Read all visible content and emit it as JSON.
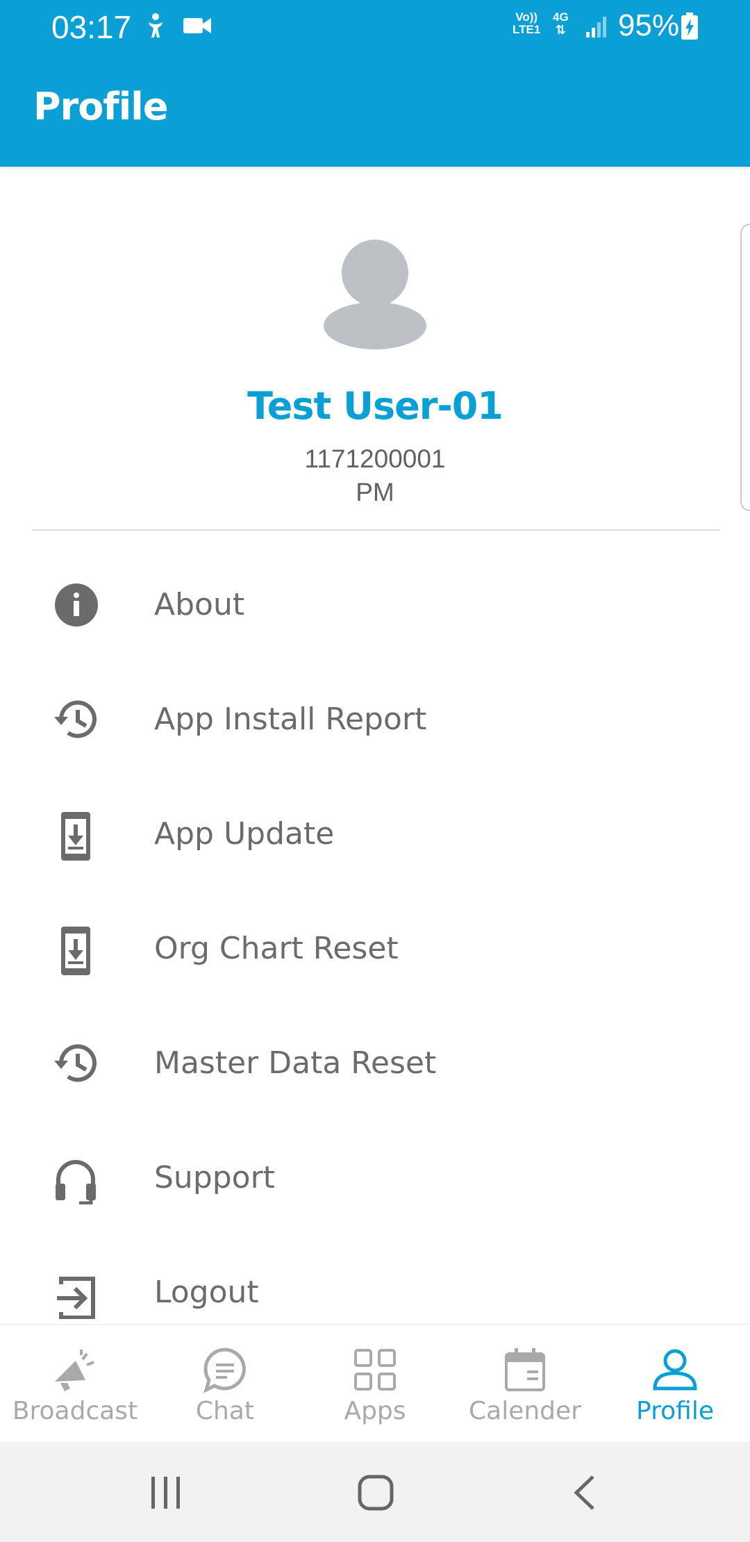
{
  "status_bar": {
    "time": "03:17",
    "network_top": "Vo))",
    "network_bottom": "LTE1",
    "generation": "4G",
    "battery": "95%"
  },
  "app_bar": {
    "title": "Profile"
  },
  "profile": {
    "name": "Test User-01",
    "id": "1171200001",
    "role": "PM"
  },
  "menu": {
    "items": [
      {
        "label": "About",
        "icon": "info-icon"
      },
      {
        "label": "App Install Report",
        "icon": "history-icon"
      },
      {
        "label": "App Update",
        "icon": "phone-download-icon"
      },
      {
        "label": "Org Chart Reset",
        "icon": "phone-download-icon"
      },
      {
        "label": "Master Data Reset",
        "icon": "history-icon"
      },
      {
        "label": "Support",
        "icon": "headset-icon"
      },
      {
        "label": "Logout",
        "icon": "logout-icon"
      }
    ]
  },
  "bottom_nav": {
    "items": [
      {
        "label": "Broadcast",
        "icon": "megaphone-icon"
      },
      {
        "label": "Chat",
        "icon": "chat-bubble-icon"
      },
      {
        "label": "Apps",
        "icon": "grid-icon"
      },
      {
        "label": "Calender",
        "icon": "calendar-icon"
      },
      {
        "label": "Profile",
        "icon": "person-icon",
        "active": true
      }
    ]
  },
  "colors": {
    "primary": "#0aa0d6",
    "icon_gray": "#6b6b6b",
    "nav_inactive": "#a9a9a9"
  }
}
